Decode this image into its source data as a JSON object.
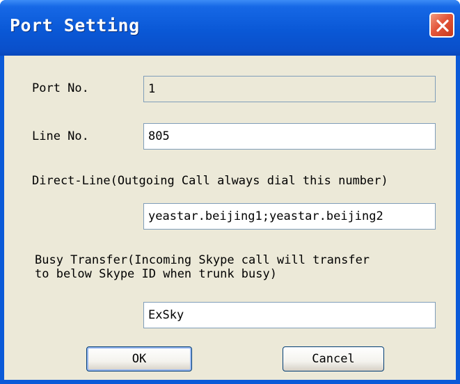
{
  "window": {
    "title": "Port Setting",
    "close_icon": "close-icon"
  },
  "form": {
    "port_no": {
      "label": "Port No.",
      "value": "1"
    },
    "line_no": {
      "label": "Line No.",
      "value": "805"
    },
    "direct_line": {
      "label": "Direct-Line(Outgoing Call always dial this number)",
      "value": "yeastar.beijing1;yeastar.beijing2"
    },
    "busy_transfer": {
      "label_line1": "Busy Transfer(Incoming Skype call will transfer",
      "label_line2": "to below Skype ID when trunk busy)",
      "value": "ExSky"
    }
  },
  "buttons": {
    "ok_label": "OK",
    "cancel_label": "Cancel"
  },
  "colors": {
    "titlebar": "#0a58d6",
    "client_bg": "#ece9d8",
    "close_button": "#e3563a"
  }
}
